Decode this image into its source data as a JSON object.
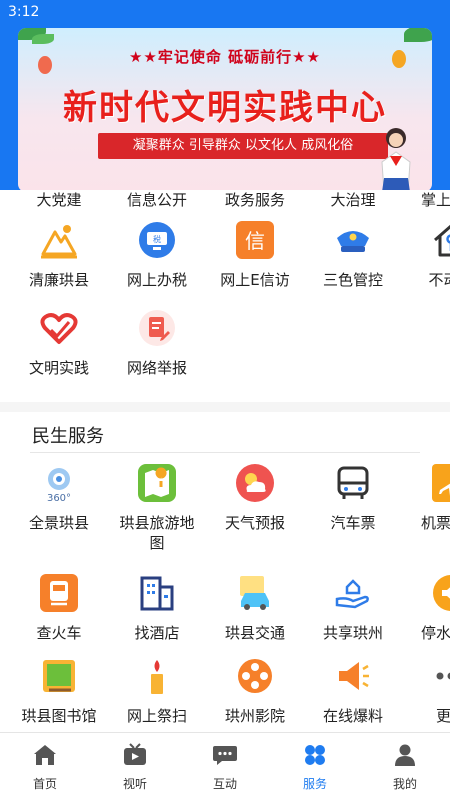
{
  "status_bar": {
    "time": "3:12"
  },
  "banner": {
    "slogan": "★★牢记使命  砥砺前行★★",
    "title": "新时代文明实践中心",
    "ribbon": "凝聚群众  引导群众  以文化人  成风化俗"
  },
  "top_row": [
    "大党建",
    "信息公开",
    "政务服务",
    "大治理",
    "掌上阳光"
  ],
  "row_a": [
    {
      "label": "清廉珙县",
      "icon": "mountain-icon"
    },
    {
      "label": "网上办税",
      "icon": "tax-monitor-icon"
    },
    {
      "label": "网上E信访",
      "icon": "letter-icon"
    },
    {
      "label": "三色管控",
      "icon": "police-cap-icon"
    },
    {
      "label": "不动产",
      "icon": "house-key-icon"
    }
  ],
  "row_b": [
    {
      "label": "文明实践",
      "icon": "heart-hand-icon"
    },
    {
      "label": "网络举报",
      "icon": "report-doc-icon"
    }
  ],
  "section": {
    "title": "民生服务"
  },
  "row_c": [
    {
      "label": "全景珙县",
      "icon": "panorama-360-icon"
    },
    {
      "label": "珙县旅游地图",
      "icon": "map-icon"
    },
    {
      "label": "天气预报",
      "icon": "weather-icon"
    },
    {
      "label": "汽车票",
      "icon": "bus-icon"
    },
    {
      "label": "机票查询",
      "icon": "plane-icon"
    }
  ],
  "row_d": [
    {
      "label": "查火车",
      "icon": "train-icon"
    },
    {
      "label": "找酒店",
      "icon": "hotel-icon"
    },
    {
      "label": "珙县交通",
      "icon": "car-icon"
    },
    {
      "label": "共享珙州",
      "icon": "share-hand-icon"
    },
    {
      "label": "停水公告",
      "icon": "speaker-icon"
    }
  ],
  "row_e": [
    {
      "label": "珙县图书馆",
      "icon": "book-icon"
    },
    {
      "label": "网上祭扫",
      "icon": "candle-icon"
    },
    {
      "label": "珙州影院",
      "icon": "film-reel-icon"
    },
    {
      "label": "在线爆料",
      "icon": "megaphone-icon"
    },
    {
      "label": "更多",
      "icon": "more-dots-icon"
    }
  ],
  "tabs": [
    {
      "label": "首页",
      "icon": "home-icon"
    },
    {
      "label": "视听",
      "icon": "tv-icon"
    },
    {
      "label": "互动",
      "icon": "chat-icon"
    },
    {
      "label": "服务",
      "icon": "grid-icon",
      "active": true
    },
    {
      "label": "我的",
      "icon": "user-icon"
    }
  ],
  "colors": {
    "primary": "#1877f2",
    "active_tab": "#1f7cf0"
  }
}
